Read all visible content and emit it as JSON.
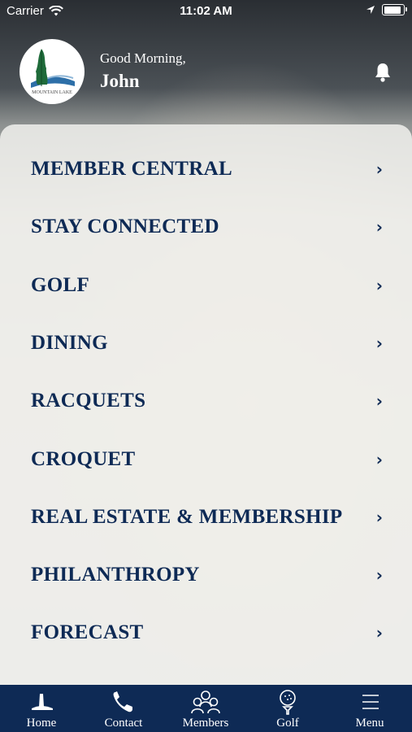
{
  "status_bar": {
    "carrier": "Carrier",
    "time": "11:02 AM"
  },
  "header": {
    "greeting": "Good Morning,",
    "user_name": "John",
    "logo_text": "MOUNTAIN LAKE"
  },
  "menu": {
    "items": [
      {
        "label": "MEMBER CENTRAL"
      },
      {
        "label": "STAY CONNECTED"
      },
      {
        "label": "GOLF"
      },
      {
        "label": "DINING"
      },
      {
        "label": "RACQUETS"
      },
      {
        "label": "CROQUET"
      },
      {
        "label": "REAL ESTATE & MEMBERSHIP"
      },
      {
        "label": "PHILANTHROPY"
      },
      {
        "label": "FORECAST"
      }
    ],
    "chevron": "›"
  },
  "tab_bar": {
    "tabs": [
      {
        "label": "Home",
        "icon": "home-lighthouse-icon"
      },
      {
        "label": "Contact",
        "icon": "phone-icon"
      },
      {
        "label": "Members",
        "icon": "members-icon"
      },
      {
        "label": "Golf",
        "icon": "golf-ball-tee-icon"
      },
      {
        "label": "Menu",
        "icon": "hamburger-menu-icon"
      }
    ]
  },
  "colors": {
    "brand_navy": "#0e2a55",
    "logo_green": "#1f6b3a",
    "logo_blue": "#2d6fa8"
  }
}
